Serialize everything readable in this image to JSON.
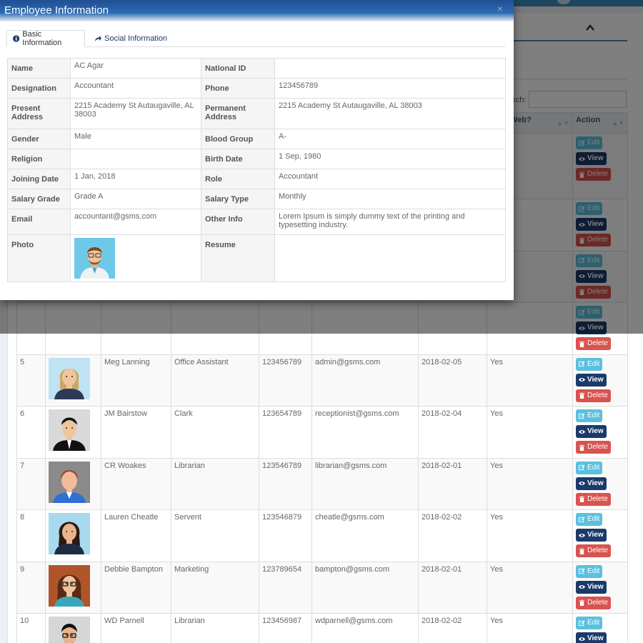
{
  "background": {
    "search_label": "arch:",
    "table": {
      "headers": {
        "web": "w on Web?",
        "action": "Action"
      },
      "rows": [
        {
          "sl": "5",
          "name": "Meg Lanning",
          "designation": "Office Assistant",
          "phone": "123456789",
          "email": "admin@gsms.com",
          "date": "2018-02-05",
          "web": "Yes",
          "avatar": "female-blonde"
        },
        {
          "sl": "6",
          "name": "JM Bairstow",
          "designation": "Clark",
          "phone": "123654789",
          "email": "receptionist@gsms.com",
          "date": "2018-02-04",
          "web": "Yes",
          "avatar": "male-suit"
        },
        {
          "sl": "7",
          "name": "CR Woakes",
          "designation": "Librarian",
          "phone": "123546789",
          "email": "librarian@gsms.com",
          "date": "2018-02-01",
          "web": "Yes",
          "avatar": "male-faceless"
        },
        {
          "sl": "8",
          "name": "Lauren Cheatle",
          "designation": "Servent",
          "phone": "123546879",
          "email": "cheatle@gsms.com",
          "date": "2018-02-02",
          "web": "Yes",
          "avatar": "female-dark-hair"
        },
        {
          "sl": "9",
          "name": "Debbie Bampton",
          "designation": "Marketing",
          "phone": "123789654",
          "email": "bampton@gsms.com",
          "date": "2018-02-01",
          "web": "Yes",
          "avatar": "female-glasses"
        },
        {
          "sl": "10",
          "name": "WD Parnell",
          "designation": "Librarian",
          "phone": "123456987",
          "email": "wdparnell@gsms.com",
          "date": "2018-02-02",
          "web": "Yes",
          "avatar": "male-glasses"
        }
      ],
      "buttons": {
        "edit": "Edit",
        "view": "View",
        "delete": "Delete"
      }
    }
  },
  "modal": {
    "title": "Employee Information",
    "close": "×",
    "tabs": [
      {
        "label": "Basic Information",
        "icon": "info-circle-icon",
        "active": true
      },
      {
        "label": "Social Information",
        "icon": "share-icon",
        "active": false
      }
    ],
    "fields": {
      "name_k": "Name",
      "name_v": "AC Agar",
      "nid_k": "National ID",
      "nid_v": "",
      "designation_k": "Designation",
      "designation_v": "Accountant",
      "phone_k": "Phone",
      "phone_v": "123456789",
      "present_k": "Present Address",
      "present_v": "2215 Academy St Autaugaville, AL 38003",
      "permanent_k": "Permanent Address",
      "permanent_v": "2215 Academy St Autaugaville, AL 38003",
      "gender_k": "Gender",
      "gender_v": "Male",
      "blood_k": "Blood Group",
      "blood_v": "A-",
      "religion_k": "Religion",
      "religion_v": "",
      "birth_k": "Birth Date",
      "birth_v": "1 Sep, 1980",
      "joining_k": "Joining Date",
      "joining_v": "1 Jan, 2018",
      "role_k": "Role",
      "role_v": "Accountant",
      "salary_grade_k": "Salary Grade",
      "salary_grade_v": "Grade A",
      "salary_type_k": "Salary Type",
      "salary_type_v": "Monthly",
      "email_k": "Email",
      "email_v": "accountant@gsms.com",
      "other_k": "Other Info",
      "other_v": "Lorem Ipsum is simply dummy text of the printing and typesetting industry.",
      "photo_k": "Photo",
      "resume_k": "Resume",
      "resume_v": ""
    }
  }
}
